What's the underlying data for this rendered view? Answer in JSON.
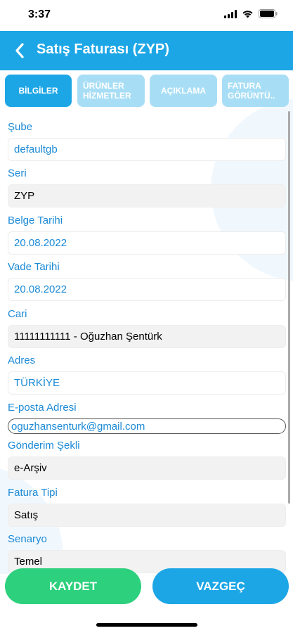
{
  "status": {
    "time": "3:37"
  },
  "nav": {
    "title": "Satış Faturası (ZYP)"
  },
  "tabs": [
    {
      "label": "BİLGİLER",
      "active": true
    },
    {
      "label": "ÜRÜNLER\nHİZMETLER",
      "active": false
    },
    {
      "label": "AÇIKLAMA",
      "active": false
    },
    {
      "label": "FATURA\nGÖRÜNTÜ..",
      "active": false
    }
  ],
  "form": {
    "sube": {
      "label": "Şube",
      "value": "defaultgb"
    },
    "seri": {
      "label": "Seri",
      "value": "ZYP"
    },
    "belge_tarihi": {
      "label": "Belge Tarihi",
      "value": "20.08.2022"
    },
    "vade_tarihi": {
      "label": "Vade Tarihi",
      "value": "20.08.2022"
    },
    "cari": {
      "label": "Cari",
      "value": "11111111111 - Oğuzhan Şentürk"
    },
    "adres": {
      "label": "Adres",
      "value": "TÜRKİYE"
    },
    "eposta": {
      "label": "E-posta Adresi",
      "value": "oguzhansenturk@gmail.com"
    },
    "gonderim": {
      "label": "Gönderim Şekli",
      "value": "e-Arşiv"
    },
    "fatura_tipi": {
      "label": "Fatura Tipi",
      "value": "Satış"
    },
    "senaryo": {
      "label": "Senaryo",
      "value": "Temel"
    }
  },
  "buttons": {
    "save": "KAYDET",
    "cancel": "VAZGEÇ"
  },
  "colors": {
    "primary": "#1ca6e6",
    "tab_inactive": "#a8def5",
    "save": "#2dd07d",
    "label": "#1c8ad6"
  }
}
